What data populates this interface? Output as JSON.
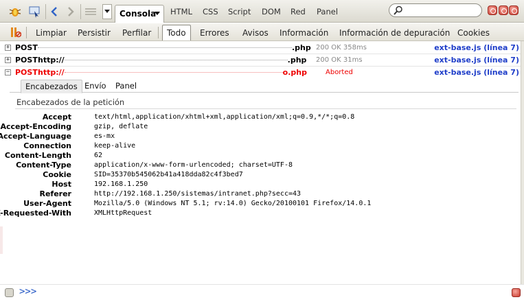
{
  "toolbar": {
    "console_label": "Consola",
    "panels": [
      "HTML",
      "CSS",
      "Script",
      "DOM",
      "Red",
      "Panel"
    ],
    "search_placeholder": ""
  },
  "filters": {
    "actions": [
      "Limpiar",
      "Persistir",
      "Perfilar"
    ],
    "levels": [
      "Todo",
      "Errores",
      "Avisos",
      "Información",
      "Información de depuración",
      "Cookies"
    ],
    "selected": "Todo"
  },
  "requests": [
    {
      "method": "POST",
      "url_prefix": "",
      "url_suffix": ".php",
      "status": "200 OK 358ms",
      "source": "ext-base.js (línea 7)",
      "expanded": false
    },
    {
      "method": "POST",
      "url_prefix": "http://",
      "url_suffix": ".php",
      "status": "200 OK 31ms",
      "source": "ext-base.js (línea 7)",
      "expanded": false
    },
    {
      "method": "POST",
      "url_prefix": "http://",
      "url_suffix": "o.php",
      "status": "Aborted",
      "source": "ext-base.js (línea 7)",
      "expanded": true
    }
  ],
  "detail": {
    "tabs": [
      "Encabezados",
      "Envío",
      "Panel"
    ],
    "selected_tab": "Encabezados",
    "section_title": "Encabezados de la petición",
    "headers": [
      {
        "key": "Accept",
        "value": "text/html,application/xhtml+xml,application/xml;q=0.9,*/*;q=0.8"
      },
      {
        "key": "Accept-Encoding",
        "value": "gzip, deflate"
      },
      {
        "key": "Accept-Language",
        "value": "es-mx"
      },
      {
        "key": "Connection",
        "value": "keep-alive"
      },
      {
        "key": "Content-Length",
        "value": "62"
      },
      {
        "key": "Content-Type",
        "value": "application/x-www-form-urlencoded; charset=UTF-8"
      },
      {
        "key": "Cookie",
        "value": "SID=35370b545062b41a418dda82c4f3bed7"
      },
      {
        "key": "Host",
        "value": "192.168.1.250"
      },
      {
        "key": "Referer",
        "value": "http://192.168.1.250/sistemas/intranet.php?secc=43"
      },
      {
        "key": "User-Agent",
        "value": "Mozilla/5.0 (Windows NT 5.1; rv:14.0) Gecko/20100101 Firefox/14.0.1"
      },
      {
        "key": "X-Requested-With",
        "value": "XMLHttpRequest"
      }
    ]
  },
  "command_line": {
    "prompt": ">>>"
  },
  "colors": {
    "error": "#ee0000",
    "link": "#1f3ec9",
    "prompt": "#2155c4"
  }
}
